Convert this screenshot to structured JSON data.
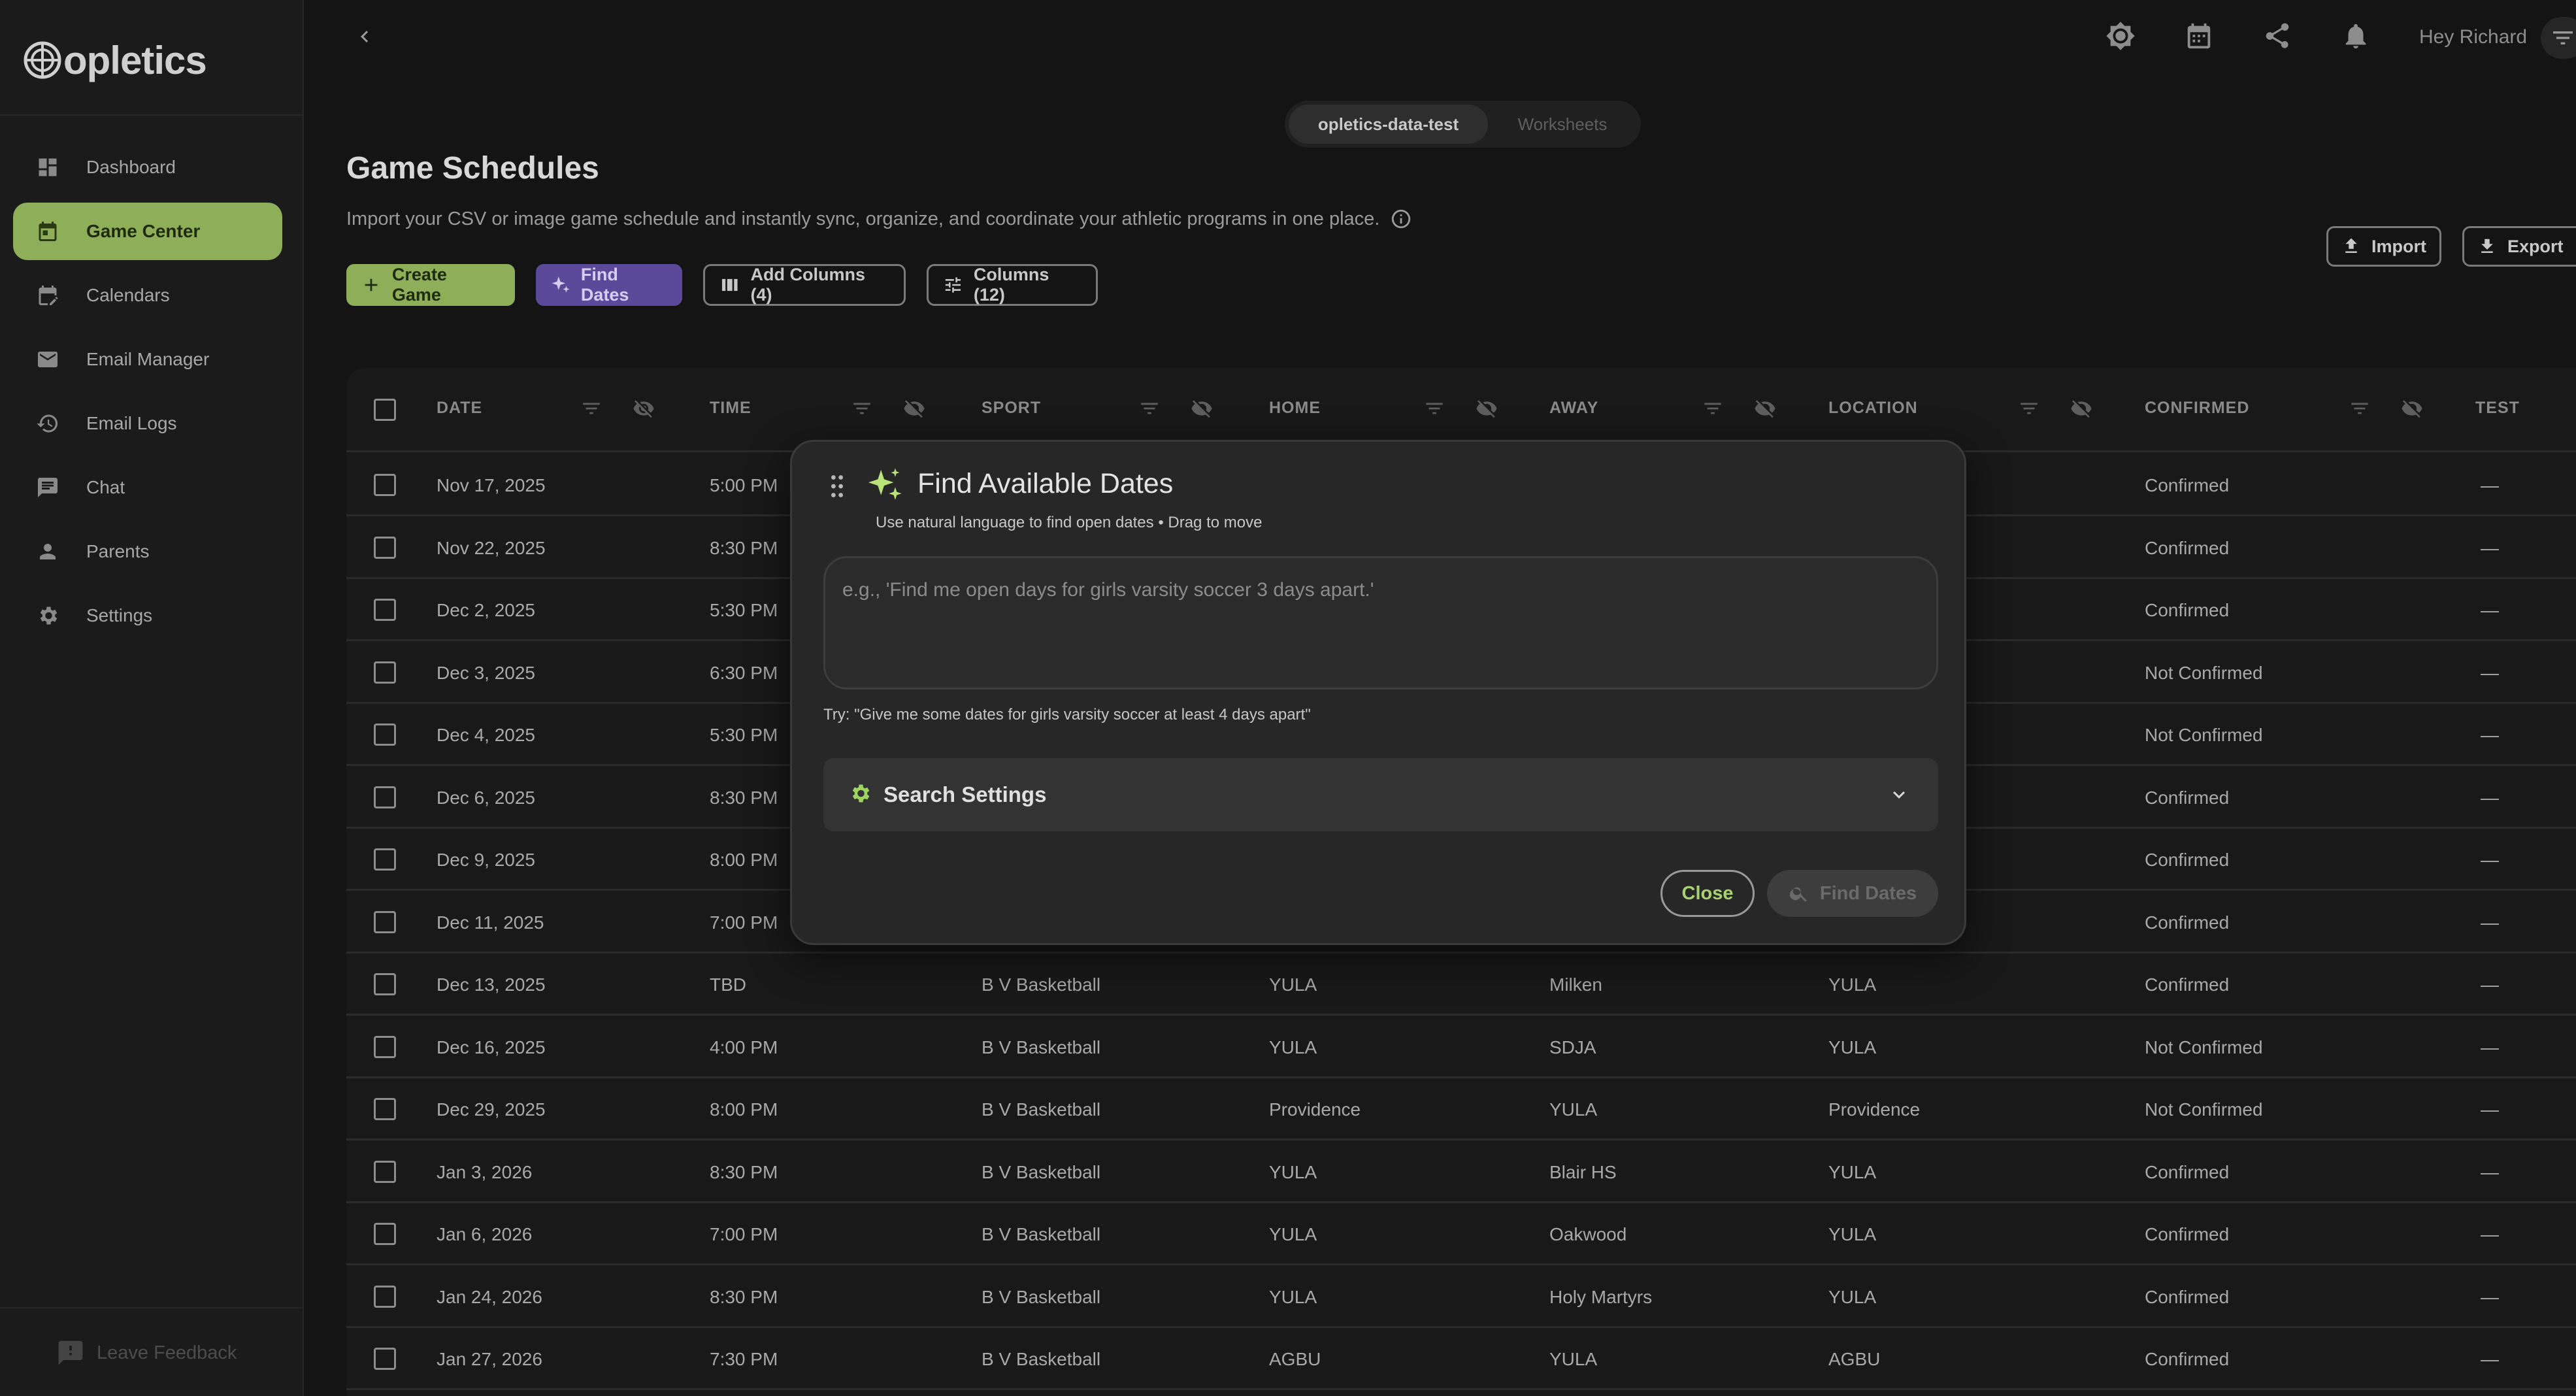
{
  "app": {
    "logo_text": "opletics"
  },
  "sidebar": {
    "items": [
      {
        "label": "Dashboard",
        "icon": "dashboard-icon",
        "active": false
      },
      {
        "label": "Game Center",
        "icon": "calendar-icon",
        "active": true
      },
      {
        "label": "Calendars",
        "icon": "calendar-edit-icon",
        "active": false
      },
      {
        "label": "Email Manager",
        "icon": "mail-icon",
        "active": false
      },
      {
        "label": "Email Logs",
        "icon": "history-icon",
        "active": false
      },
      {
        "label": "Chat",
        "icon": "chat-icon",
        "active": false
      },
      {
        "label": "Parents",
        "icon": "person-icon",
        "active": false
      },
      {
        "label": "Settings",
        "icon": "gear-icon",
        "active": false
      }
    ],
    "feedback_label": "Leave Feedback"
  },
  "topbar": {
    "greeting": "Hey Richard",
    "icons": [
      "brightness-icon",
      "calendar-icon",
      "share-icon",
      "bell-icon"
    ]
  },
  "workspace": {
    "active": "opletics-data-test",
    "inactive": "Worksheets"
  },
  "header": {
    "title": "Game Schedules",
    "subtitle": "Import your CSV or image game schedule and instantly sync, organize, and coordinate your athletic programs in one place."
  },
  "toolbar": {
    "create": "Create Game",
    "find": "Find Dates",
    "add_columns": "Add Columns (4)",
    "columns": "Columns (12)",
    "import": "Import",
    "export": "Export"
  },
  "table": {
    "columns": [
      "DATE",
      "TIME",
      "SPORT",
      "HOME",
      "AWAY",
      "LOCATION",
      "CONFIRMED",
      "TEST"
    ],
    "rows": [
      [
        "Nov 17, 2025",
        "5:00 PM",
        "",
        "",
        "",
        "",
        "Confirmed",
        "—"
      ],
      [
        "Nov 22, 2025",
        "8:30 PM",
        "",
        "",
        "",
        "",
        "Confirmed",
        "—"
      ],
      [
        "Dec 2, 2025",
        "5:30 PM",
        "",
        "",
        "",
        "",
        "Confirmed",
        "—"
      ],
      [
        "Dec 3, 2025",
        "6:30 PM",
        "",
        "",
        "",
        "",
        "Not Confirmed",
        "—"
      ],
      [
        "Dec 4, 2025",
        "5:30 PM",
        "",
        "",
        "",
        "",
        "Not Confirmed",
        "—"
      ],
      [
        "Dec 6, 2025",
        "8:30 PM",
        "",
        "",
        "",
        "",
        "Confirmed",
        "—"
      ],
      [
        "Dec 9, 2025",
        "8:00 PM",
        "",
        "",
        "",
        "",
        "Confirmed",
        "—"
      ],
      [
        "Dec 11, 2025",
        "7:00 PM",
        "",
        "",
        "",
        "",
        "Confirmed",
        "—"
      ],
      [
        "Dec 13, 2025",
        "TBD",
        "B V Basketball",
        "YULA",
        "Milken",
        "YULA",
        "Confirmed",
        "—"
      ],
      [
        "Dec 16, 2025",
        "4:00 PM",
        "B V Basketball",
        "YULA",
        "SDJA",
        "YULA",
        "Not Confirmed",
        "—"
      ],
      [
        "Dec 29, 2025",
        "8:00 PM",
        "B V Basketball",
        "Providence",
        "YULA",
        "Providence",
        "Not Confirmed",
        "—"
      ],
      [
        "Jan 3, 2026",
        "8:30 PM",
        "B V Basketball",
        "YULA",
        "Blair HS",
        "YULA",
        "Confirmed",
        "—"
      ],
      [
        "Jan 6, 2026",
        "7:00 PM",
        "B V Basketball",
        "YULA",
        "Oakwood",
        "YULA",
        "Confirmed",
        "—"
      ],
      [
        "Jan 24, 2026",
        "8:30 PM",
        "B V Basketball",
        "YULA",
        "Holy Martyrs",
        "YULA",
        "Confirmed",
        "—"
      ],
      [
        "Jan 27, 2026",
        "7:30 PM",
        "B V Basketball",
        "AGBU",
        "YULA",
        "AGBU",
        "Confirmed",
        "—"
      ]
    ]
  },
  "modal": {
    "title": "Find Available Dates",
    "subtitle": "Use natural language to find open dates • Drag to move",
    "placeholder": "e.g., 'Find me open days for girls varsity soccer 3 days apart.'",
    "try_hint": "Try: \"Give me some dates for girls varsity soccer at least 4 days apart\"",
    "settings_label": "Search Settings",
    "close_label": "Close",
    "find_label": "Find Dates"
  },
  "colors": {
    "accent_green": "#8fae5a",
    "accent_purple": "#5b4a9a",
    "sparkle": "#b9e27a",
    "background": "#141414"
  }
}
